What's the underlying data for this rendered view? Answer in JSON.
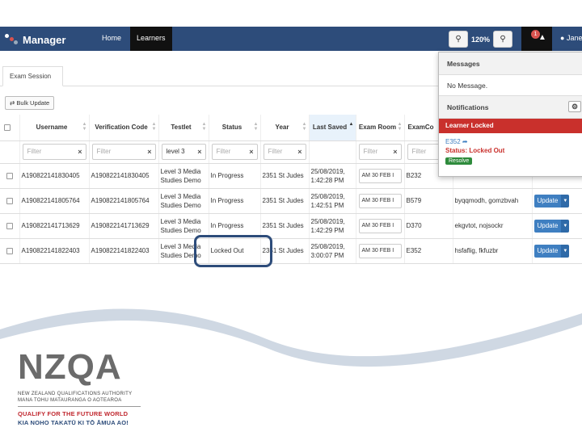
{
  "app": {
    "title": "Manager",
    "nav": {
      "home": "Home",
      "learners": "Learners"
    },
    "zoom": "120%",
    "notification_count": "1",
    "user": "Jane"
  },
  "tab": {
    "label": "Exam Session"
  },
  "toolbar": {
    "bulk_update": "Bulk Update"
  },
  "table": {
    "headers": {
      "username": "Username",
      "verification_code": "Verification Code",
      "testlet": "Testlet",
      "status": "Status",
      "year": "Year",
      "last_saved": "Last Saved",
      "exam_room": "Exam Room",
      "exam_code": "ExamCo"
    },
    "filter_placeholder": "Filter",
    "testlet_filter": "level 3",
    "rows": [
      {
        "username": "A190822141830405",
        "code": "A190822141830405",
        "testlet": "Level 3 Media Studies Demo",
        "status": "In Progress",
        "year": "2351 St Judes",
        "saved": "25/08/2019, 1:42:28 PM",
        "room": "AM 30 FEB I",
        "exam": "B232",
        "names": "",
        "action": ""
      },
      {
        "username": "A190822141805764",
        "code": "A190822141805764",
        "testlet": "Level 3 Media Studies Demo",
        "status": "In Progress",
        "year": "2351 St Judes",
        "saved": "25/08/2019, 1:42:51 PM",
        "room": "AM 30 FEB I",
        "exam": "B579",
        "names": "byqqmodh, gomzbvah",
        "action": "Update"
      },
      {
        "username": "A190822141713629",
        "code": "A190822141713629",
        "testlet": "Level 3 Media Studies Demo",
        "status": "In Progress",
        "year": "2351 St Judes",
        "saved": "25/08/2019, 1:42:29 PM",
        "room": "AM 30 FEB I",
        "exam": "D370",
        "names": "ekgvtot, nojsockr",
        "action": "Update"
      },
      {
        "username": "A190822141822403",
        "code": "A190822141822403",
        "testlet": "Level 3 Media Studies Demo",
        "status": "Locked Out",
        "year": "2351 St Judes",
        "saved": "25/08/2019, 3:00:07 PM",
        "room": "AM 30 FEB I",
        "exam": "E352",
        "names": "hsfaflig, fkfuzbr",
        "action": "Update"
      }
    ]
  },
  "panel": {
    "messages_title": "Messages",
    "messages_body": "No Message.",
    "notifications_title": "Notifications",
    "alert_title": "Learner Locked",
    "alert_code": "E352",
    "alert_status": "Status: Locked Out",
    "resolve": "Resolve"
  },
  "footer": {
    "logo_word": "NZQA",
    "org_line1": "NEW ZEALAND QUALIFICATIONS AUTHORITY",
    "org_line2": "MANA TOHU MATAURANGA O AOTEAROA",
    "tagline1": "QUALIFY FOR THE FUTURE WORLD",
    "tagline2": "KIA NOHO TAKATŪ KI TŌ ĀMUA AO!"
  },
  "colors": {
    "nav": "#2d4c7a",
    "alert": "#c9302c",
    "button": "#3f7fc1",
    "resolve": "#2e8b3c"
  }
}
